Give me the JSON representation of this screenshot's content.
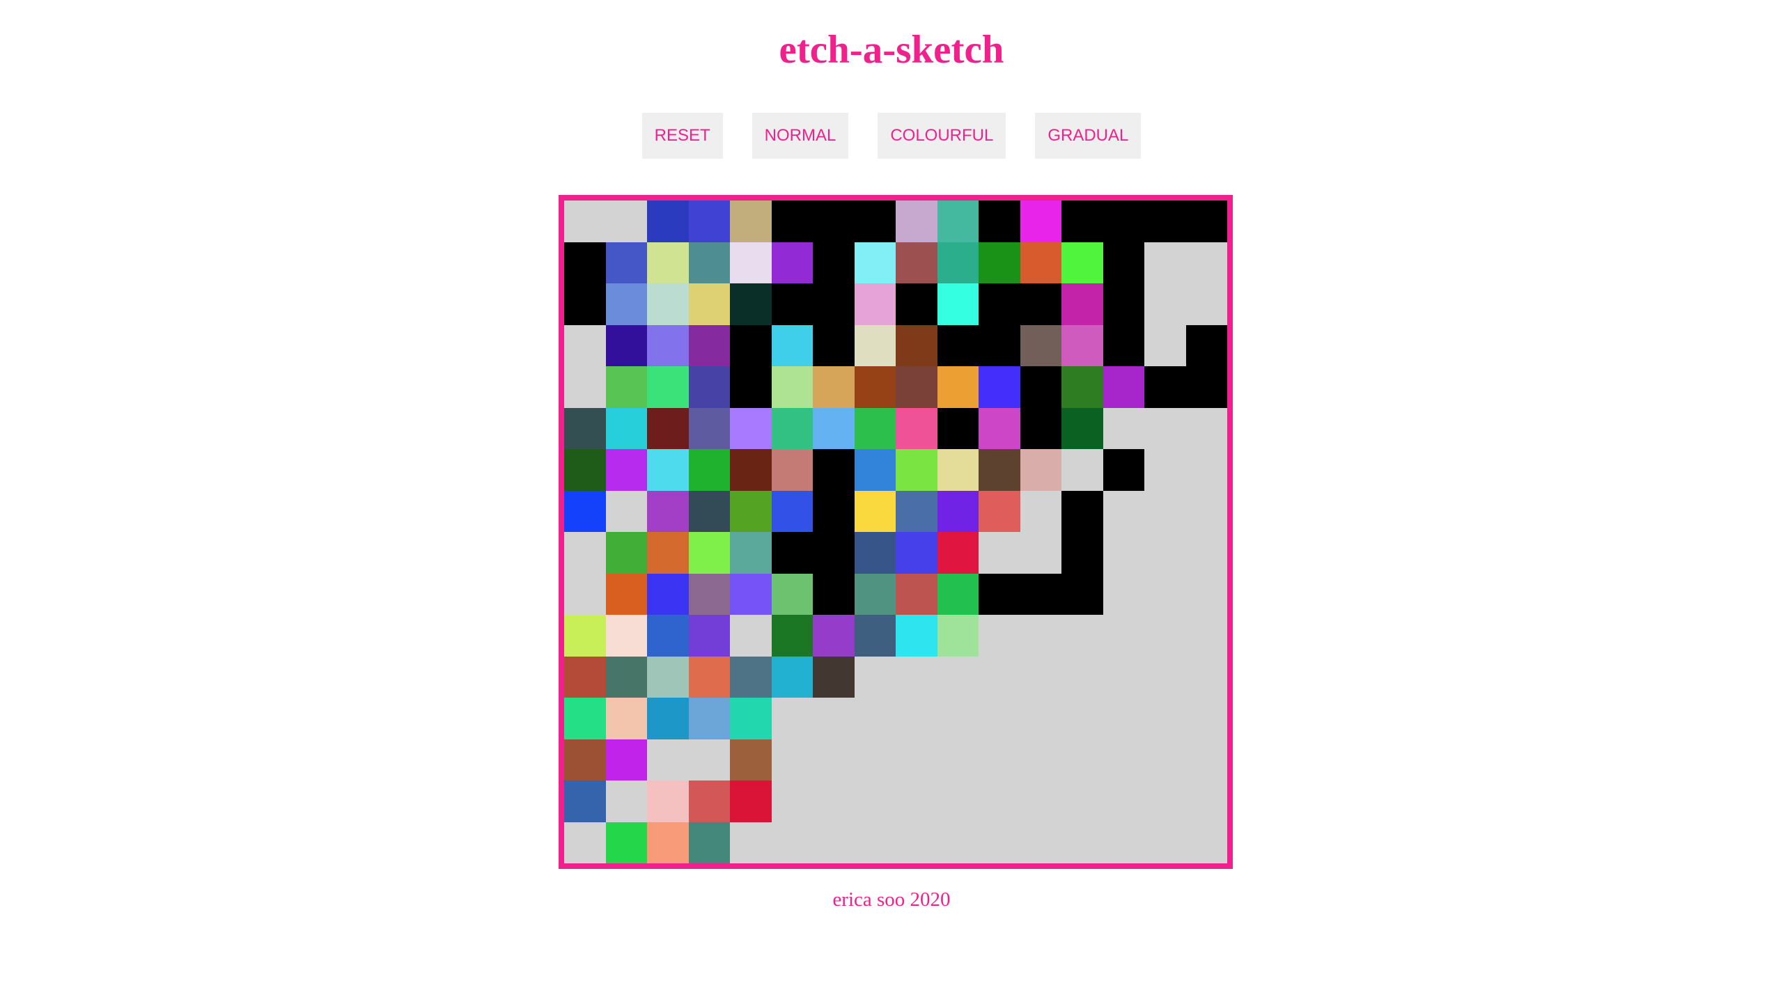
{
  "page": {
    "title": "etch-a-sketch",
    "footer": "erica soo 2020"
  },
  "toolbar": {
    "buttons": [
      {
        "label": "RESET"
      },
      {
        "label": "NORMAL"
      },
      {
        "label": "COLOURFUL"
      },
      {
        "label": "GRADUAL"
      }
    ]
  },
  "colors": {
    "accent": "#f0218c",
    "button_bg": "#efefef",
    "empty_cell": "#d3d3d3"
  },
  "grid": {
    "size": 16,
    "cells": [
      [
        "#d3d3d3",
        "#d3d3d3",
        "#2b3bbf",
        "#4042d3",
        "#c2ad7d",
        "#000000",
        "#000000",
        "#000000",
        "#c7a9d0",
        "#45b99f",
        "#000000",
        "#e823ea",
        "#000000",
        "#000000",
        "#000000",
        "#000000"
      ],
      [
        "#000000",
        "#4556c7",
        "#d0e393",
        "#4e8d91",
        "#e8dcee",
        "#922ad6",
        "#000000",
        "#82eff7",
        "#9c5050",
        "#2aae8c",
        "#1a9217",
        "#d75b2c",
        "#50f43d",
        "#000000",
        "#d3d3d3",
        "#d3d3d3"
      ],
      [
        "#000000",
        "#6a8cdb",
        "#bbddd1",
        "#ddd173",
        "#0a2e28",
        "#000000",
        "#000000",
        "#e5a3d7",
        "#000000",
        "#34ffe1",
        "#000000",
        "#000000",
        "#c223a8",
        "#000000",
        "#d3d3d3",
        "#d3d3d3"
      ],
      [
        "#d3d3d3",
        "#33109b",
        "#8273ec",
        "#862a9f",
        "#000000",
        "#40cfea",
        "#000000",
        "#e0dec0",
        "#7f3a19",
        "#000000",
        "#000000",
        "#735f59",
        "#d05bbf",
        "#000000",
        "#d3d3d3",
        "#000000"
      ],
      [
        "#d3d3d3",
        "#58c454",
        "#3be279",
        "#4642a6",
        "#000000",
        "#aee394",
        "#d6a55a",
        "#974216",
        "#7a4139",
        "#ec9f32",
        "#442efb",
        "#000000",
        "#2e7d23",
        "#a726cc",
        "#000000",
        "#000000"
      ],
      [
        "#344f51",
        "#27cfdb",
        "#6d1e1c",
        "#5e5ba0",
        "#a77aff",
        "#32c183",
        "#65b2f2",
        "#2cbf4c",
        "#ef5296",
        "#000000",
        "#cd46c7",
        "#000000",
        "#0b6121",
        "#d3d3d3",
        "#d3d3d3",
        "#d3d3d3"
      ],
      [
        "#1f5c1a",
        "#b72bee",
        "#4fdbee",
        "#1fb22f",
        "#692414",
        "#c57b75",
        "#000000",
        "#3284db",
        "#7ae542",
        "#e4dc99",
        "#5d4230",
        "#d8adaa",
        "#d3d3d3",
        "#000000",
        "#d3d3d3",
        "#d3d3d3"
      ],
      [
        "#1342fa",
        "#d3d3d3",
        "#a23fc6",
        "#334b56",
        "#54a322",
        "#3252e7",
        "#000000",
        "#fad93e",
        "#4a6fa8",
        "#7022e5",
        "#df5e5b",
        "#d3d3d3",
        "#000000",
        "#d3d3d3",
        "#d3d3d3",
        "#d3d3d3"
      ],
      [
        "#d3d3d3",
        "#40ae37",
        "#d56a2f",
        "#7fef4a",
        "#5aa99a",
        "#000000",
        "#000000",
        "#38558a",
        "#4540e9",
        "#e01640",
        "#d3d3d3",
        "#d3d3d3",
        "#000000",
        "#d3d3d3",
        "#d3d3d3",
        "#d3d3d3"
      ],
      [
        "#d3d3d3",
        "#d85f1f",
        "#3b34f3",
        "#8b6991",
        "#7653f6",
        "#6cc26e",
        "#000000",
        "#509381",
        "#bd5450",
        "#22c04e",
        "#000000",
        "#000000",
        "#000000",
        "#d3d3d3",
        "#d3d3d3",
        "#d3d3d3"
      ],
      [
        "#c8ef57",
        "#f7ddd3",
        "#2f64cf",
        "#733dd8",
        "#d3d3d3",
        "#1b7723",
        "#963cca",
        "#3e5f80",
        "#2ee4ef",
        "#9fe29a",
        "#d3d3d3",
        "#d3d3d3",
        "#d3d3d3",
        "#d3d3d3",
        "#d3d3d3",
        "#d3d3d3"
      ],
      [
        "#b44b39",
        "#477669",
        "#9ec5b8",
        "#df6c4c",
        "#4e7386",
        "#22b1d1",
        "#433831",
        "#d3d3d3",
        "#d3d3d3",
        "#d3d3d3",
        "#d3d3d3",
        "#d3d3d3",
        "#d3d3d3",
        "#d3d3d3",
        "#d3d3d3",
        "#d3d3d3"
      ],
      [
        "#24df86",
        "#f4c5ad",
        "#1d97c8",
        "#6ca5d8",
        "#22d7ae",
        "#d3d3d3",
        "#d3d3d3",
        "#d3d3d3",
        "#d3d3d3",
        "#d3d3d3",
        "#d3d3d3",
        "#d3d3d3",
        "#d3d3d3",
        "#d3d3d3",
        "#d3d3d3",
        "#d3d3d3"
      ],
      [
        "#9c5034",
        "#c223ea",
        "#d3d3d3",
        "#d3d3d3",
        "#9d603d",
        "#d3d3d3",
        "#d3d3d3",
        "#d3d3d3",
        "#d3d3d3",
        "#d3d3d3",
        "#d3d3d3",
        "#d3d3d3",
        "#d3d3d3",
        "#d3d3d3",
        "#d3d3d3",
        "#d3d3d3"
      ],
      [
        "#3564ad",
        "#d3d3d3",
        "#f4c1c0",
        "#d25756",
        "#da1436",
        "#d3d3d3",
        "#d3d3d3",
        "#d3d3d3",
        "#d3d3d3",
        "#d3d3d3",
        "#d3d3d3",
        "#d3d3d3",
        "#d3d3d3",
        "#d3d3d3",
        "#d3d3d3",
        "#d3d3d3"
      ],
      [
        "#d3d3d3",
        "#24d64a",
        "#f89b78",
        "#43887a",
        "#d3d3d3",
        "#d3d3d3",
        "#d3d3d3",
        "#d3d3d3",
        "#d3d3d3",
        "#d3d3d3",
        "#d3d3d3",
        "#d3d3d3",
        "#d3d3d3",
        "#d3d3d3",
        "#d3d3d3",
        "#d3d3d3"
      ]
    ]
  }
}
